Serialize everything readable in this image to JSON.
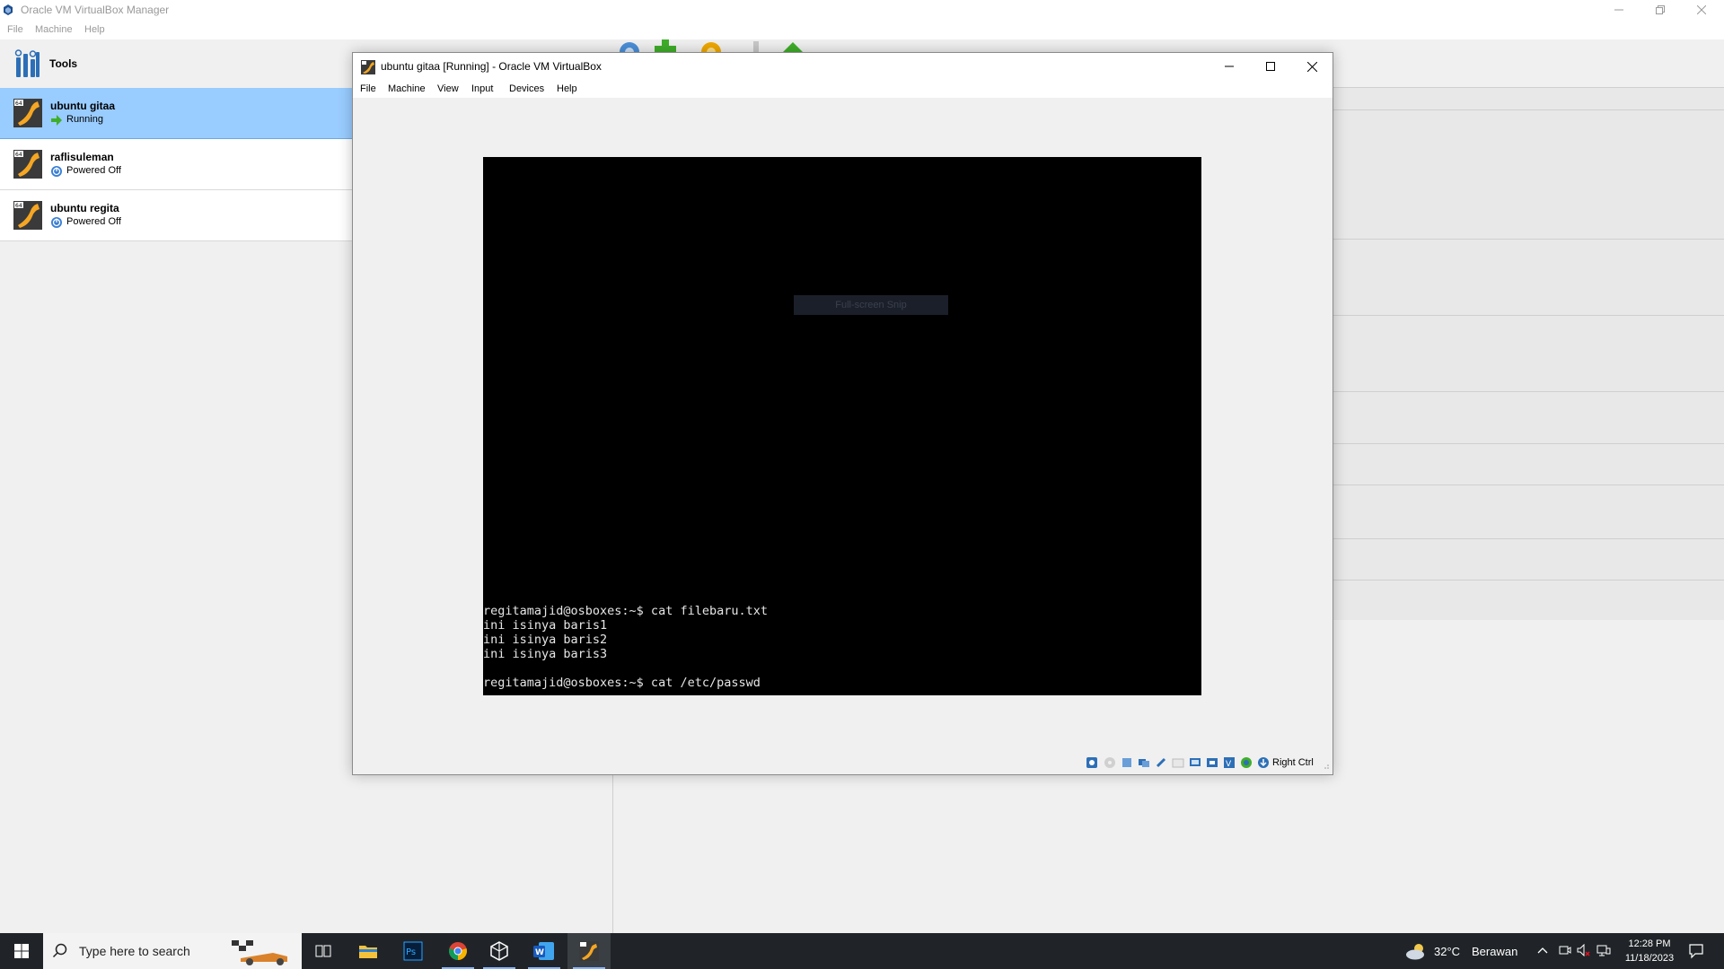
{
  "manager": {
    "title": "Oracle VM VirtualBox Manager",
    "menu": [
      "File",
      "Machine",
      "Help"
    ],
    "tools_label": "Tools",
    "vms": [
      {
        "name": "ubuntu gitaa",
        "state": "Running",
        "selected": true
      },
      {
        "name": "raflisuleman",
        "state": "Powered Off",
        "selected": false
      },
      {
        "name": "ubuntu regita",
        "state": "Powered Off",
        "selected": false
      }
    ]
  },
  "vm_window": {
    "title": "ubuntu gitaa [Running] - Oracle VM VirtualBox",
    "menu": [
      "File",
      "Machine",
      "View",
      "Input",
      "Devices",
      "Help"
    ],
    "snip_overlay": "Full-screen Snip",
    "terminal_lines": [
      "regitamajid@osboxes:~$ cat filebaru.txt",
      "ini isinya baris1",
      "ini isinya baris2",
      "ini isinya baris3",
      "",
      "regitamajid@osboxes:~$ cat /etc/passwd"
    ],
    "host_key": "Right Ctrl"
  },
  "taskbar": {
    "search_placeholder": "Type here to search",
    "weather_temp": "32°C",
    "weather_desc": "Berawan",
    "time": "12:28 PM",
    "date": "11/18/2023"
  },
  "colors": {
    "selected_row": "#99ccff",
    "taskbar": "#202428",
    "guest_screen": "#000000"
  }
}
